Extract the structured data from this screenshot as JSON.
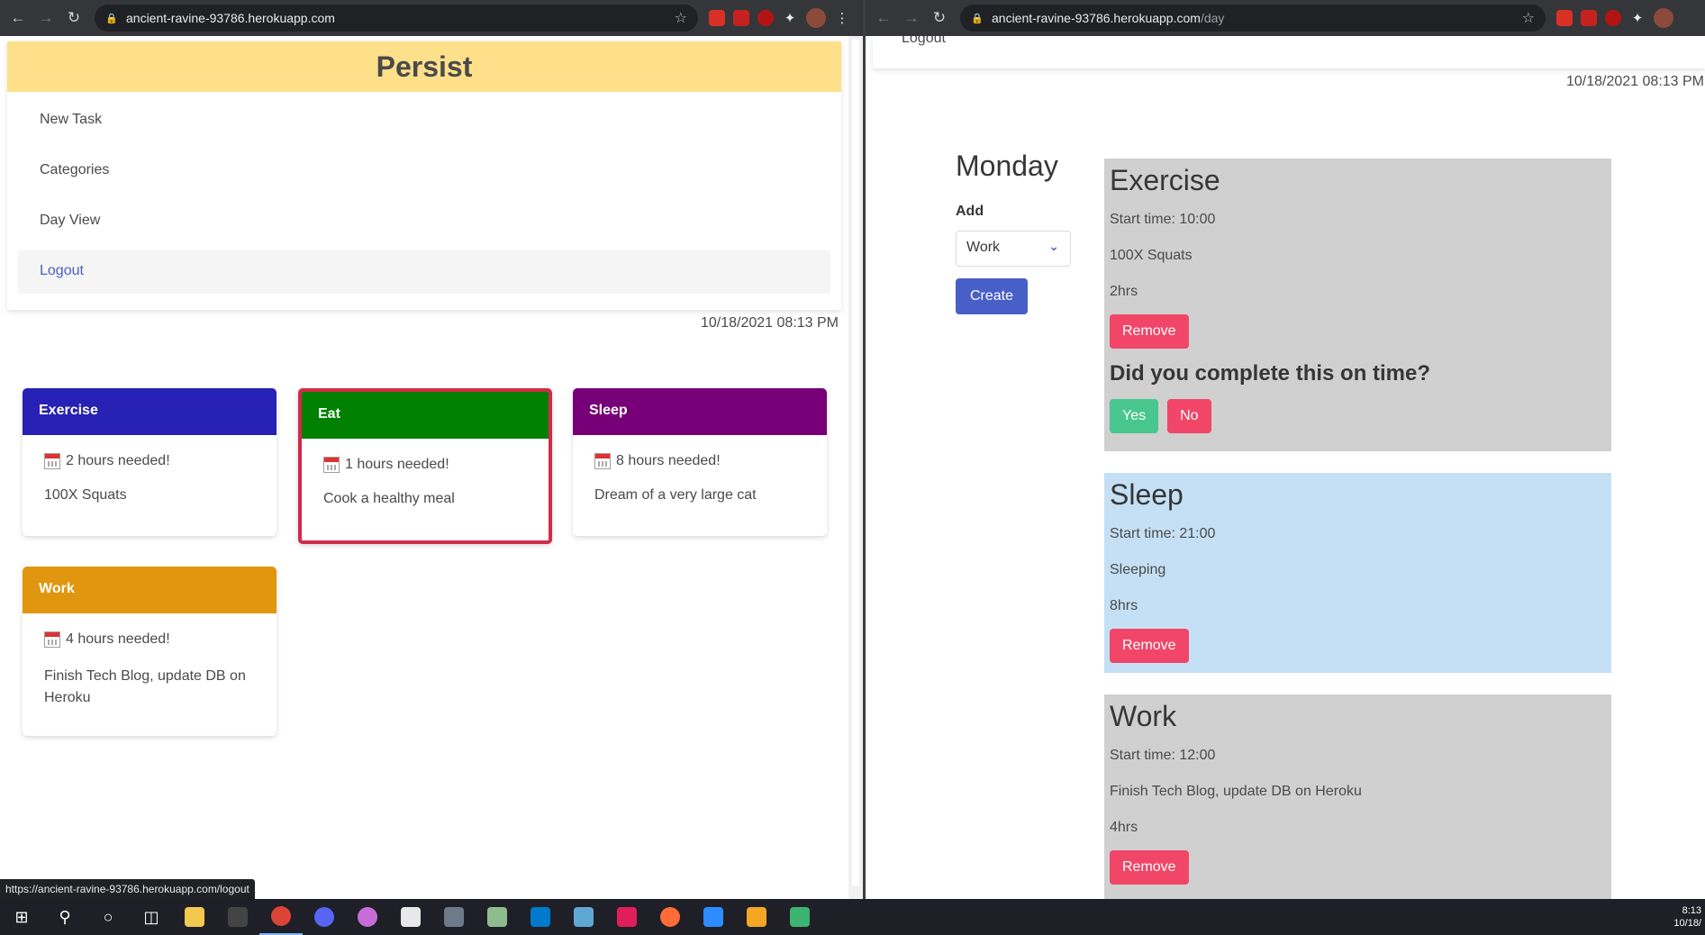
{
  "left_browser": {
    "url": "ancient-ravine-93786.herokuapp.com",
    "url_path": ""
  },
  "right_browser": {
    "url": "ancient-ravine-93786.herokuapp.com",
    "url_path": "/day"
  },
  "left_page": {
    "brand": "Persist",
    "menu": [
      {
        "label": "New Task"
      },
      {
        "label": "Categories"
      },
      {
        "label": "Day View"
      },
      {
        "label": "Logout"
      }
    ],
    "timestamp": "10/18/2021 08:13 PM",
    "cards": [
      {
        "title": "Exercise",
        "hours": "2 hours needed!",
        "desc": "100X Squats",
        "color": "#2821b5"
      },
      {
        "title": "Eat",
        "hours": "1 hours needed!",
        "desc": "Cook a healthy meal",
        "color": "#008000"
      },
      {
        "title": "Sleep",
        "hours": "8 hours needed!",
        "desc": "Dream of a very large cat",
        "color": "#770078"
      },
      {
        "title": "Work",
        "hours": "4 hours needed!",
        "desc": "Finish Tech Blog, update DB on Heroku",
        "color": "#e0960f"
      }
    ]
  },
  "right_page": {
    "nav_logout": "Logout",
    "timestamp": "10/18/2021 08:13 PM",
    "day": "Monday",
    "add_label": "Add",
    "select_value": "Work",
    "create_label": "Create",
    "tasks": [
      {
        "title": "Exercise",
        "start": "Start time: 10:00",
        "desc": "100X Squats",
        "duration": "2hrs",
        "remove": "Remove",
        "bg": "#d0d0d0"
      },
      {
        "title": "Sleep",
        "start": "Start time: 21:00",
        "desc": "Sleeping",
        "duration": "8hrs",
        "remove": "Remove",
        "bg": "#c5e0f5"
      },
      {
        "title": "Work",
        "start": "Start time: 12:00",
        "desc": "Finish Tech Blog, update DB on Heroku",
        "duration": "4hrs",
        "remove": "Remove",
        "bg": "#d0d0d0"
      }
    ],
    "complete_question": "Did you complete this on time?",
    "yes_label": "Yes",
    "no_label": "No"
  },
  "status_bar_url": "https://ancient-ravine-93786.herokuapp.com/logout",
  "taskbar": {
    "time": "8:13",
    "date": "10/18/"
  }
}
